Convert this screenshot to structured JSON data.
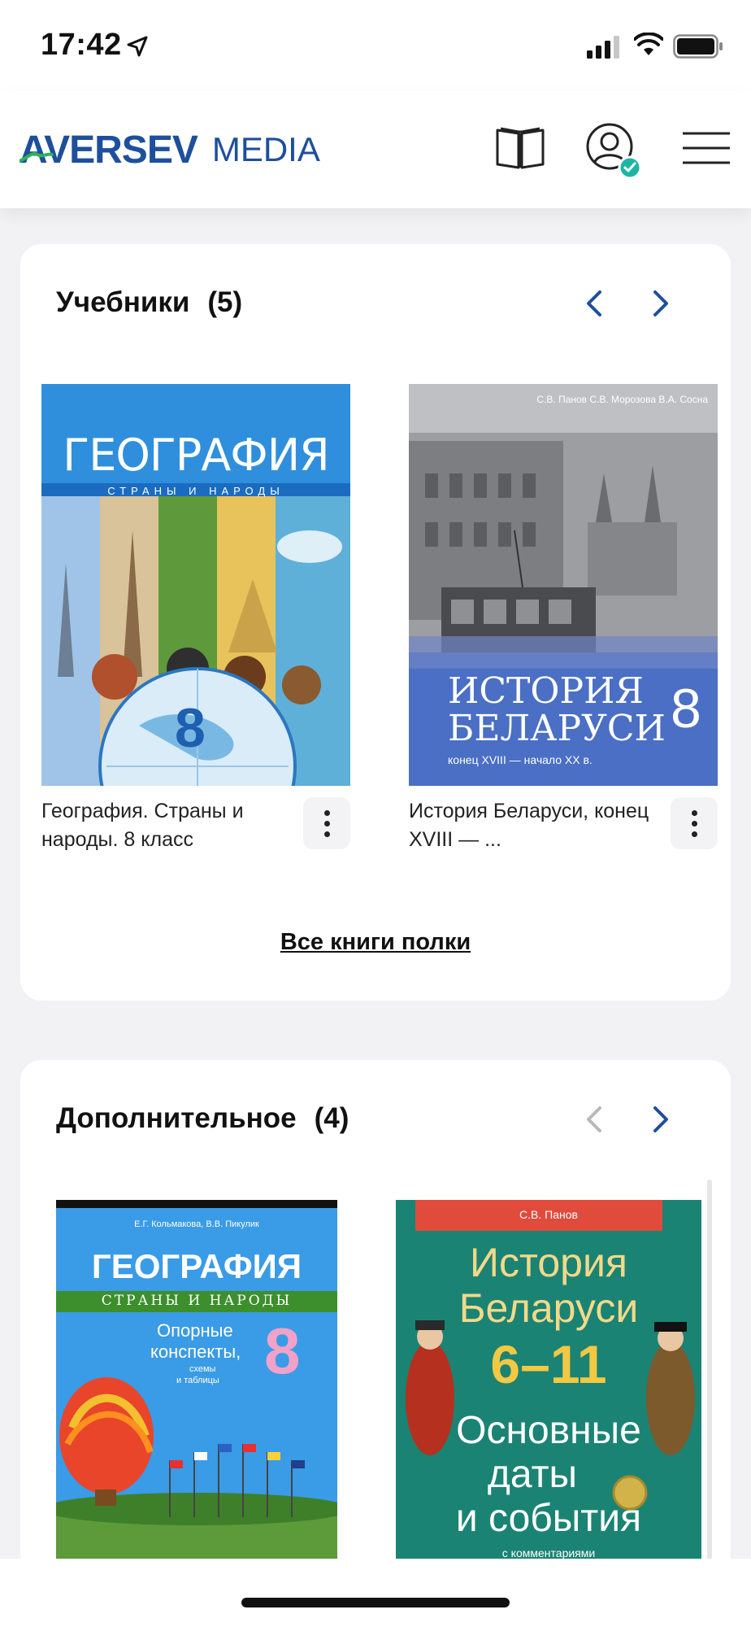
{
  "status_bar": {
    "time": "17:42"
  },
  "brand": {
    "name_primary": "AVERSEV",
    "name_secondary": "MEDIA",
    "color": "#1e4f9c"
  },
  "sections": [
    {
      "title": "Учебники",
      "count": "(5)",
      "books": [
        {
          "caption": "География. Страны и народы. 8 класс",
          "cover": {
            "title": "ГЕОГРАФИЯ",
            "subtitle": "СТРАНЫ И НАРОДЫ",
            "grade": "8"
          }
        },
        {
          "caption": "История Беларуси, конец XVIII — ...",
          "cover": {
            "authors": "С.В. Панов  С.В. Морозова  В.А. Сосна",
            "title_line1": "ИСТОРИЯ",
            "title_line2": "БЕЛАРУСИ",
            "grade": "8",
            "subtitle": "конец XVIII — начало XX в."
          }
        }
      ],
      "all_books_link": "Все книги полки"
    },
    {
      "title": "Дополнительное",
      "count": "(4)",
      "books": [
        {
          "cover": {
            "authors": "Е.Г. Кольмакова, В.В. Пикулик",
            "title": "ГЕОГРАФИЯ",
            "subtitle": "СТРАНЫ И НАРОДЫ",
            "desc_line1": "Опорные",
            "desc_line2": "конспекты,",
            "desc_line3": "схемы",
            "desc_line4": "и таблицы",
            "grade": "8"
          }
        },
        {
          "cover": {
            "authors": "С.В. Панов",
            "title_line1": "История",
            "title_line2": "Беларуси",
            "range": "6–11",
            "desc_line1": "Основные",
            "desc_line2": "даты",
            "desc_line3": "и события",
            "footer": "с комментариями"
          }
        }
      ]
    }
  ],
  "colors": {
    "accent": "#1e4f9c",
    "badge": "#1fb5a5"
  }
}
